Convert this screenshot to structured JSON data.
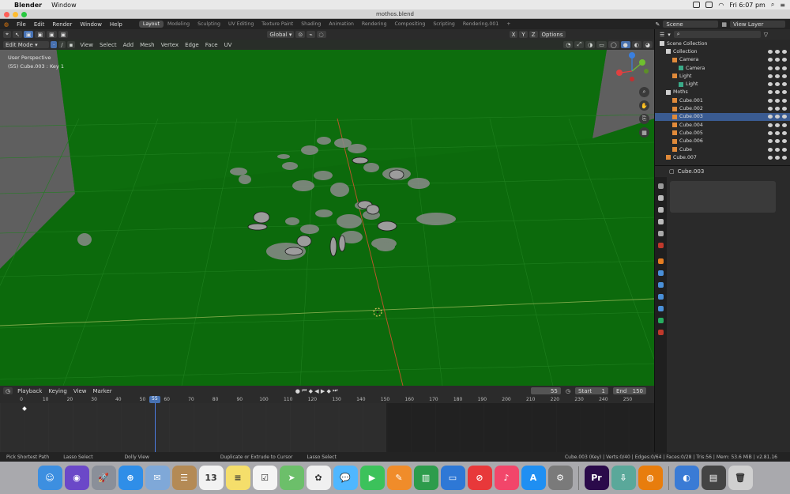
{
  "mac_menubar": {
    "app_name": "Blender",
    "items": [
      "Window"
    ],
    "clock": "Fri 6:07 pm"
  },
  "window": {
    "title": "mothos.blend"
  },
  "topbar": {
    "menus": [
      "File",
      "Edit",
      "Render",
      "Window",
      "Help"
    ],
    "workspace_tabs": [
      "Layout",
      "Modeling",
      "Sculpting",
      "UV Editing",
      "Texture Paint",
      "Shading",
      "Animation",
      "Rendering",
      "Compositing",
      "Scripting",
      "Rendering.001"
    ],
    "active_tab": "Layout",
    "scene": "Scene",
    "view_layer": "View Layer"
  },
  "viewport": {
    "mode": "Edit Mode",
    "menus": [
      "View",
      "Select",
      "Add",
      "Mesh",
      "Vertex",
      "Edge",
      "Face",
      "UV"
    ],
    "orientation": "Global",
    "options_label": "Options",
    "perspective_label": "User Perspective",
    "object_info": "(55) Cube.003 : Key 1",
    "axis_labels": [
      "X",
      "Y",
      "Z"
    ],
    "background_color": "#0c6a0c"
  },
  "outliner": {
    "rows": [
      {
        "label": "Scene Collection",
        "indent": 0,
        "type": "collection"
      },
      {
        "label": "Collection",
        "indent": 1,
        "type": "collection"
      },
      {
        "label": "Camera",
        "indent": 2,
        "type": "camera"
      },
      {
        "label": "Camera",
        "indent": 3,
        "type": "camera-data"
      },
      {
        "label": "Light",
        "indent": 2,
        "type": "light"
      },
      {
        "label": "Light",
        "indent": 3,
        "type": "light-data"
      },
      {
        "label": "Moths",
        "indent": 1,
        "type": "collection"
      },
      {
        "label": "Cube.001",
        "indent": 2,
        "type": "mesh"
      },
      {
        "label": "Cube.002",
        "indent": 2,
        "type": "mesh"
      },
      {
        "label": "Cube.003",
        "indent": 2,
        "type": "mesh",
        "selected": true
      },
      {
        "label": "Cube.004",
        "indent": 2,
        "type": "mesh"
      },
      {
        "label": "Cube.005",
        "indent": 2,
        "type": "mesh"
      },
      {
        "label": "Cube.006",
        "indent": 2,
        "type": "mesh"
      },
      {
        "label": "Cube",
        "indent": 2,
        "type": "mesh"
      },
      {
        "label": "Cube.007",
        "indent": 1,
        "type": "mesh"
      }
    ]
  },
  "properties": {
    "object_name": "Cube.003"
  },
  "timeline": {
    "menus": [
      "Playback",
      "Keying",
      "View",
      "Marker"
    ],
    "current_frame": "55",
    "start_label": "Start",
    "start": "1",
    "end_label": "End",
    "end": "150",
    "ruler": [
      "0",
      "10",
      "20",
      "30",
      "40",
      "50",
      "60",
      "70",
      "80",
      "90",
      "100",
      "110",
      "120",
      "130",
      "140",
      "150",
      "160",
      "170",
      "180",
      "190",
      "200",
      "210",
      "220",
      "230",
      "240",
      "250"
    ]
  },
  "statusbar": {
    "left": [
      "Pick Shortest Path",
      "Lasso Select",
      "Dolly View",
      "Duplicate or Extrude to Cursor",
      "Lasso Select"
    ],
    "right": "Cube.003 (Key) | Verts:0/40 | Edges:0/64 | Faces:0/28 | Tris:56 | Mem: 53.6 MiB | v2.81.16"
  },
  "dock": {
    "apps": [
      {
        "name": "finder",
        "color": "#3d8fe0",
        "glyph": "☺"
      },
      {
        "name": "siri",
        "color": "#6b48c8",
        "glyph": "◉"
      },
      {
        "name": "launchpad",
        "color": "#8a8f99",
        "glyph": "🚀"
      },
      {
        "name": "safari",
        "color": "#2f8ee8",
        "glyph": "⊕"
      },
      {
        "name": "mail",
        "color": "#7fa8d8",
        "glyph": "✉"
      },
      {
        "name": "contacts",
        "color": "#b48a55",
        "glyph": "☰"
      },
      {
        "name": "calendar",
        "color": "#f2f2f2",
        "glyph": "13"
      },
      {
        "name": "notes",
        "color": "#f5de6b",
        "glyph": "≡"
      },
      {
        "name": "reminders",
        "color": "#f4f4f4",
        "glyph": "☑"
      },
      {
        "name": "maps",
        "color": "#6cbf6a",
        "glyph": "➤"
      },
      {
        "name": "photos",
        "color": "#f0f0f0",
        "glyph": "✿"
      },
      {
        "name": "messages",
        "color": "#4fb7ff",
        "glyph": "💬"
      },
      {
        "name": "facetime",
        "color": "#3cc25b",
        "glyph": "▶"
      },
      {
        "name": "pages",
        "color": "#f08c2a",
        "glyph": "✎"
      },
      {
        "name": "numbers",
        "color": "#2d9c4c",
        "glyph": "▥"
      },
      {
        "name": "keynote",
        "color": "#2e78d6",
        "glyph": "▭"
      },
      {
        "name": "news",
        "color": "#e8383a",
        "glyph": "⊘"
      },
      {
        "name": "music",
        "color": "#f2466a",
        "glyph": "♪"
      },
      {
        "name": "app-store",
        "color": "#1f8ff2",
        "glyph": "A"
      },
      {
        "name": "system-preferences",
        "color": "#7a7a7a",
        "glyph": "⚙"
      },
      {
        "name": "premiere",
        "color": "#2a0a4a",
        "glyph": "Pr"
      },
      {
        "name": "plugin-scan",
        "color": "#5aa89a",
        "glyph": "⇩"
      },
      {
        "name": "blender",
        "color": "#e87d0d",
        "glyph": "◍"
      },
      {
        "name": "network",
        "color": "#3a7bd5",
        "glyph": "◐"
      },
      {
        "name": "photos-stack",
        "color": "#444",
        "glyph": "▤"
      },
      {
        "name": "trash",
        "color": "#d0d0d0",
        "glyph": "🗑"
      }
    ]
  }
}
